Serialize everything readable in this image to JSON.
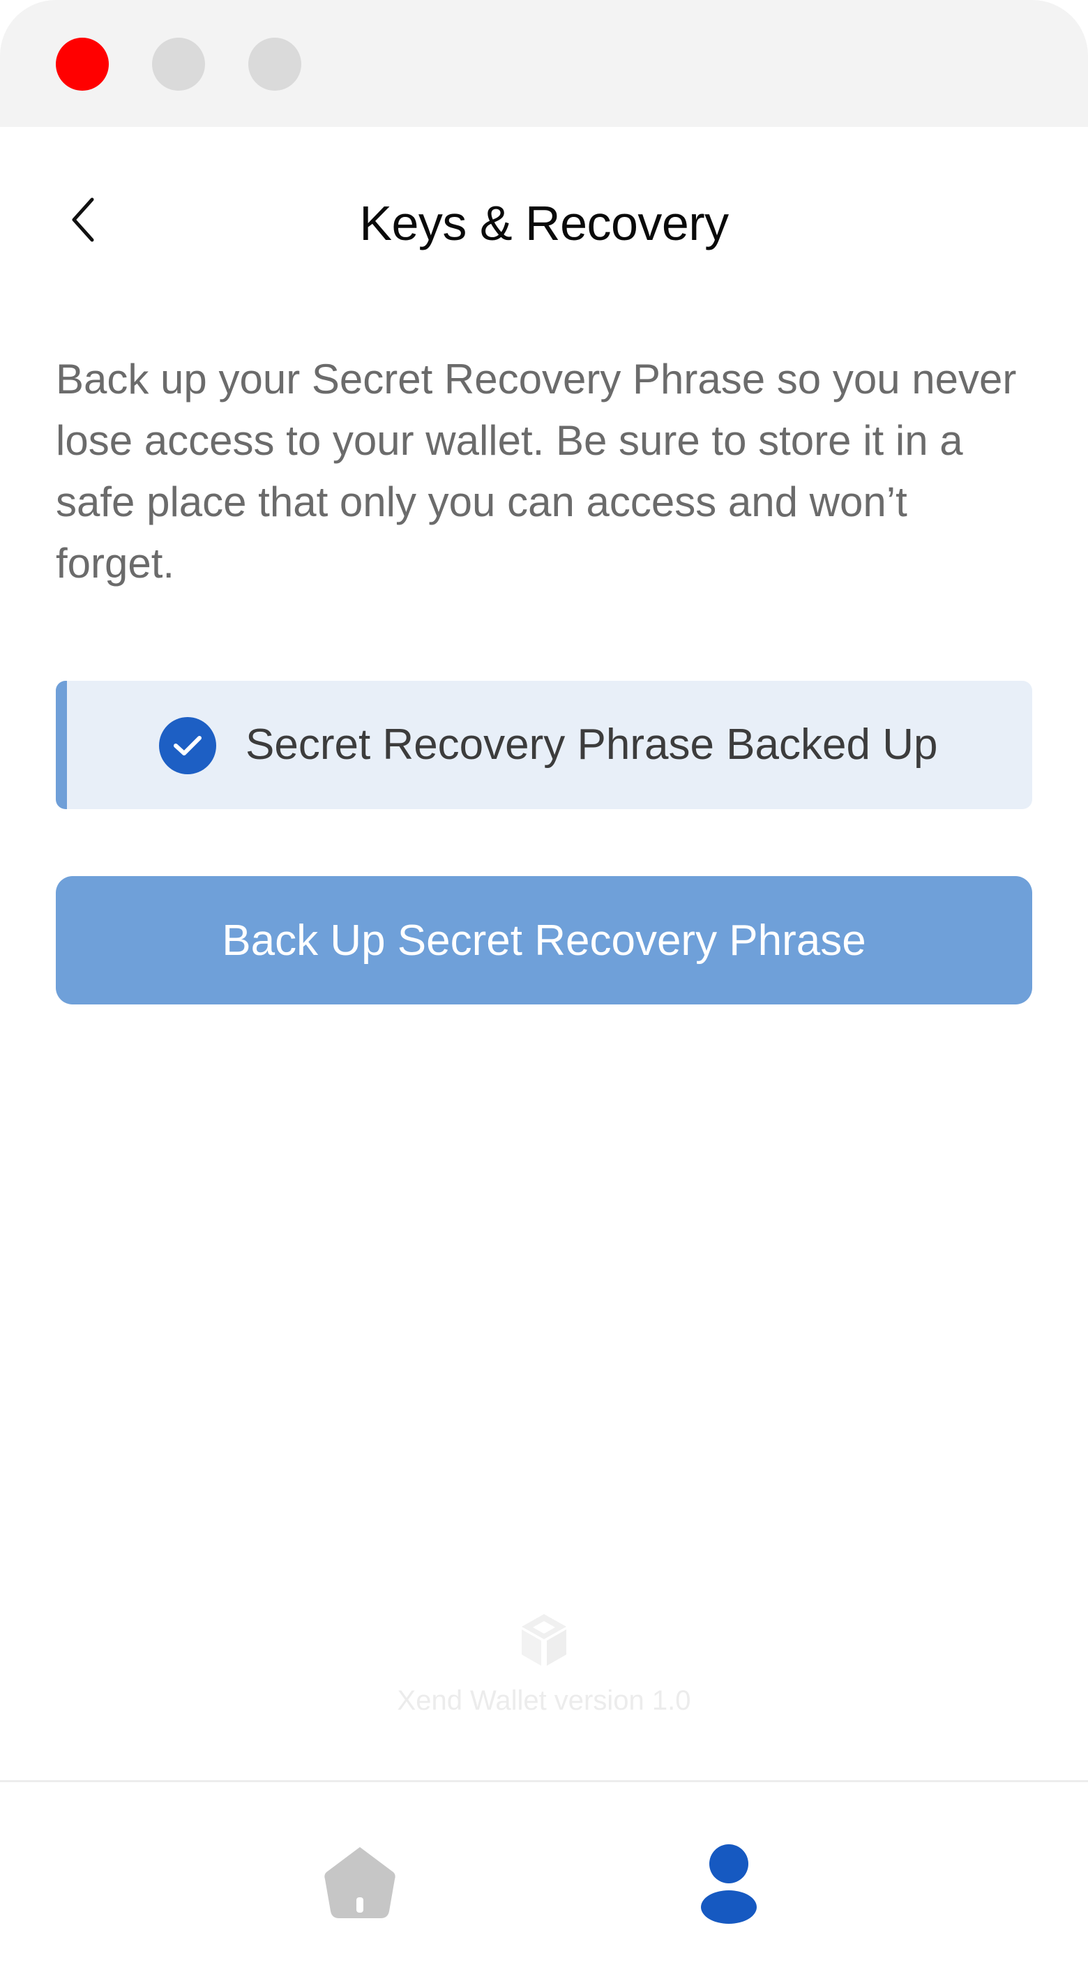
{
  "window": {
    "controls": [
      "close",
      "minimize",
      "maximize"
    ],
    "colors": {
      "close": "#ff0000",
      "inactive": "#dadada"
    }
  },
  "header": {
    "back_icon": "chevron-left-icon",
    "title": "Keys & Recovery"
  },
  "main": {
    "description": "Back up your Secret Recovery Phrase so you never lose access to your wallet. Be sure to store it in a safe place that only you can access and won’t forget.",
    "status": {
      "icon": "check-circle-icon",
      "label": "Secret Recovery Phrase Backed Up",
      "accent_color": "#6f9fd8",
      "icon_color": "#1d5fc4"
    },
    "primary_button": {
      "label": "Back Up Secret Recovery Phrase",
      "color": "#6fa0d9"
    }
  },
  "footer": {
    "logo_icon": "cube-logo-icon",
    "version": "Xend Wallet version 1.0"
  },
  "bottom_nav": {
    "items": [
      {
        "icon": "home-icon",
        "active": false
      },
      {
        "icon": "profile-icon",
        "active": true
      }
    ],
    "active_color": "#1659c1",
    "inactive_color": "#c6c6c6"
  }
}
